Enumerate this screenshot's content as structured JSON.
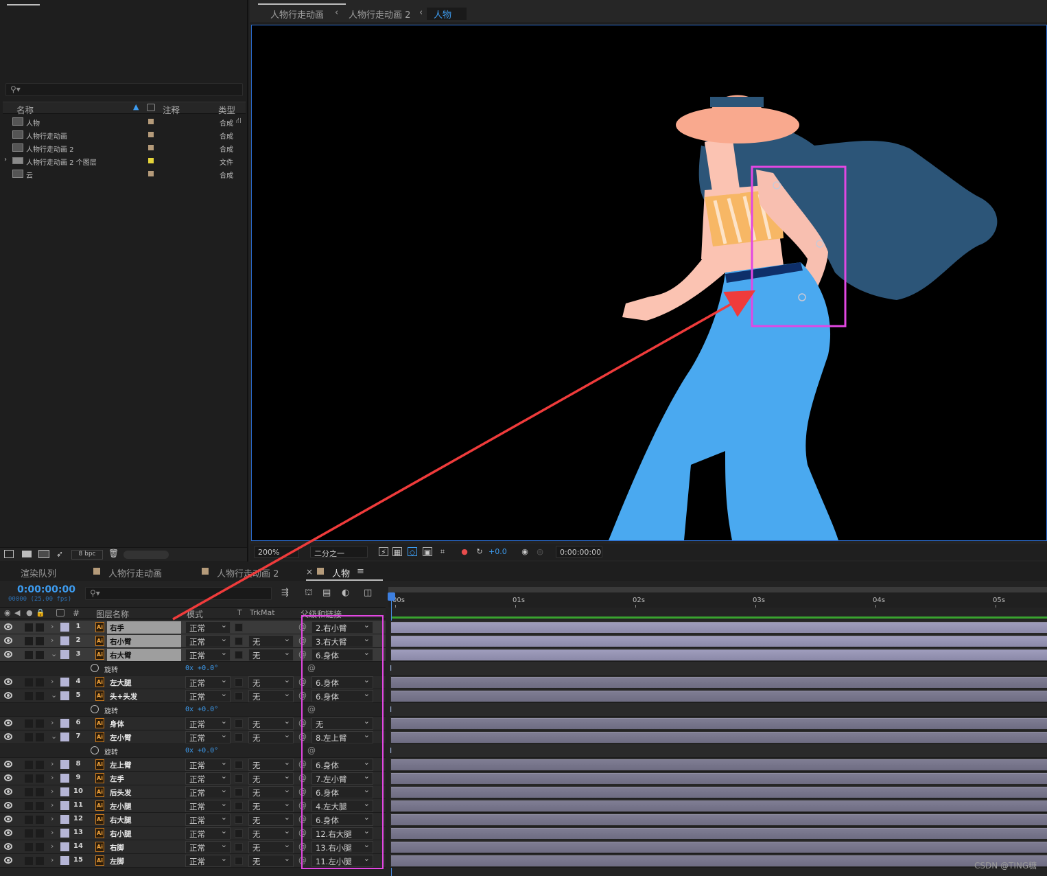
{
  "project": {
    "columns": {
      "name": "名称",
      "comment": "注释",
      "type": "类型"
    },
    "items": [
      {
        "name": "人物",
        "type": "合成",
        "kind": "comp"
      },
      {
        "name": "人物行走动画",
        "type": "合成",
        "kind": "comp"
      },
      {
        "name": "人物行走动画 2",
        "type": "合成",
        "kind": "comp"
      },
      {
        "name": "人物行走动画 2 个图层",
        "type": "文件",
        "kind": "folder"
      },
      {
        "name": "云",
        "type": "合成",
        "kind": "comp"
      }
    ],
    "bpc": "8 bpc"
  },
  "viewer": {
    "breadcrumbs": [
      "人物行走动画",
      "人物行走动画 2",
      "人物"
    ],
    "zoom": "200%",
    "resolution": "二分之一",
    "exposure": "+0.0",
    "timecode": "0:00:00:00"
  },
  "timeline": {
    "tabs": [
      "渲染队列",
      "人物行走动画",
      "人物行走动画 2",
      "人物"
    ],
    "current_time": "0:00:00:00",
    "fps_label": "00000 (25.00 fps)",
    "col_num": "#",
    "col_layer_name": "图层名称",
    "col_mode": "模式",
    "col_t": "T",
    "col_trkmat": "TrkMat",
    "col_parent": "父级和链接",
    "ruler_ticks": [
      "00s",
      "01s",
      "02s",
      "03s",
      "04s",
      "05s"
    ],
    "rows": [
      {
        "kind": "layer",
        "num": "1",
        "name": "右手",
        "mode": "正常",
        "trkmat": "",
        "parent": "2.右小臂",
        "twirl": "›",
        "selected": true
      },
      {
        "kind": "layer",
        "num": "2",
        "name": "右小臂",
        "mode": "正常",
        "trkmat": "无",
        "parent": "3.右大臂",
        "twirl": "›",
        "selected": true
      },
      {
        "kind": "layer",
        "num": "3",
        "name": "右大臂",
        "mode": "正常",
        "trkmat": "无",
        "parent": "6.身体",
        "twirl": "⌄",
        "selected": true
      },
      {
        "kind": "prop",
        "name": "旋转",
        "value": "0x +0.0°"
      },
      {
        "kind": "layer",
        "num": "4",
        "name": "左大腿",
        "mode": "正常",
        "trkmat": "无",
        "parent": "6.身体",
        "twirl": "›",
        "selected": false
      },
      {
        "kind": "layer",
        "num": "5",
        "name": "头+头发",
        "mode": "正常",
        "trkmat": "无",
        "parent": "6.身体",
        "twirl": "⌄",
        "selected": false
      },
      {
        "kind": "prop",
        "name": "旋转",
        "value": "0x +0.0°"
      },
      {
        "kind": "layer",
        "num": "6",
        "name": "身体",
        "mode": "正常",
        "trkmat": "无",
        "parent": "无",
        "twirl": "›",
        "selected": false
      },
      {
        "kind": "layer",
        "num": "7",
        "name": "左小臂",
        "mode": "正常",
        "trkmat": "无",
        "parent": "8.左上臂",
        "twirl": "⌄",
        "selected": false
      },
      {
        "kind": "prop",
        "name": "旋转",
        "value": "0x +0.0°"
      },
      {
        "kind": "layer",
        "num": "8",
        "name": "左上臂",
        "mode": "正常",
        "trkmat": "无",
        "parent": "6.身体",
        "twirl": "›",
        "selected": false
      },
      {
        "kind": "layer",
        "num": "9",
        "name": "左手",
        "mode": "正常",
        "trkmat": "无",
        "parent": "7.左小臂",
        "twirl": "›",
        "selected": false
      },
      {
        "kind": "layer",
        "num": "10",
        "name": "后头发",
        "mode": "正常",
        "trkmat": "无",
        "parent": "6.身体",
        "twirl": "›",
        "selected": false
      },
      {
        "kind": "layer",
        "num": "11",
        "name": "左小腿",
        "mode": "正常",
        "trkmat": "无",
        "parent": "4.左大腿",
        "twirl": "›",
        "selected": false
      },
      {
        "kind": "layer",
        "num": "12",
        "name": "右大腿",
        "mode": "正常",
        "trkmat": "无",
        "parent": "6.身体",
        "twirl": "›",
        "selected": false
      },
      {
        "kind": "layer",
        "num": "13",
        "name": "右小腿",
        "mode": "正常",
        "trkmat": "无",
        "parent": "12.右大腿",
        "twirl": "›",
        "selected": false
      },
      {
        "kind": "layer",
        "num": "14",
        "name": "右脚",
        "mode": "正常",
        "trkmat": "无",
        "parent": "13.右小腿",
        "twirl": "›",
        "selected": false
      },
      {
        "kind": "layer",
        "num": "15",
        "name": "左脚",
        "mode": "正常",
        "trkmat": "无",
        "parent": "11.左小腿",
        "twirl": "›",
        "selected": false
      }
    ]
  },
  "colors": {
    "accent": "#3d9cf0",
    "highlight": "#e247e2",
    "annotation_arrow": "#ef3b3b",
    "work_area": "#39a32f"
  },
  "credit": "CSDN @TING糖"
}
